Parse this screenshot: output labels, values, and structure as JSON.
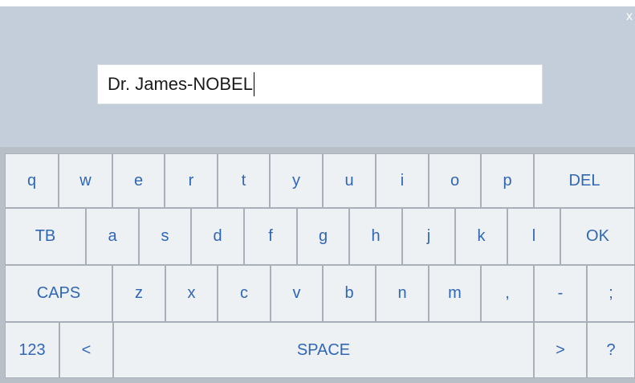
{
  "window": {
    "close_label": "x"
  },
  "input": {
    "value": "Dr. James-NOBEL"
  },
  "keyboard": {
    "row1": [
      "q",
      "w",
      "e",
      "r",
      "t",
      "y",
      "u",
      "i",
      "o",
      "p",
      "DEL"
    ],
    "row2": [
      "TB",
      "a",
      "s",
      "d",
      "f",
      "g",
      "h",
      "j",
      "k",
      "l",
      "OK"
    ],
    "row3": [
      "CAPS",
      "z",
      "x",
      "c",
      "v",
      "b",
      "n",
      "m",
      ",",
      "-",
      ";"
    ],
    "row4": [
      "123",
      "<",
      "SPACE",
      ">",
      "?"
    ]
  }
}
